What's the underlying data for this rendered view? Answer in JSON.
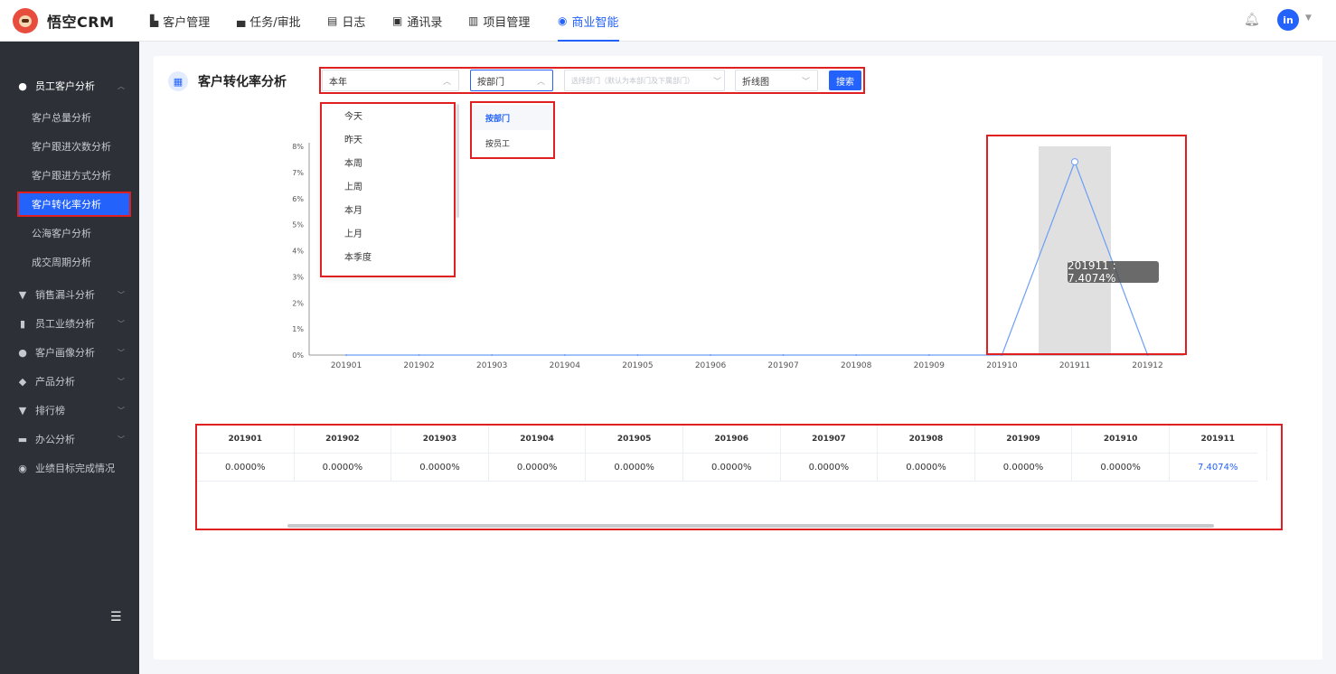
{
  "app": {
    "name": "悟空CRM"
  },
  "topnav": [
    {
      "icon": "▙",
      "label": "客户管理",
      "x": 166
    },
    {
      "icon": "▄",
      "label": "任务/审批",
      "x": 262
    },
    {
      "icon": "▤",
      "label": "日志",
      "x": 362
    },
    {
      "icon": "▣",
      "label": "通讯录",
      "x": 434
    },
    {
      "icon": "▥",
      "label": "项目管理",
      "x": 518
    },
    {
      "icon": "◉",
      "label": "商业智能",
      "x": 617
    }
  ],
  "user": {
    "avatar": "in"
  },
  "sidebar": {
    "group_staff": "员工客户分析",
    "items": [
      "客户总量分析",
      "客户跟进次数分析",
      "客户跟进方式分析",
      "客户转化率分析",
      "公海客户分析",
      "成交周期分析"
    ],
    "groups": [
      "销售漏斗分析",
      "员工业绩分析",
      "客户画像分析",
      "产品分析",
      "排行榜",
      "办公分析",
      "业绩目标完成情况"
    ]
  },
  "page": {
    "title": "客户转化率分析"
  },
  "filters": {
    "time": "本年",
    "dimension": "按部门",
    "dept_placeholder": "选择部门（默认为本部门及下属部门）",
    "chart_type": "折线图",
    "search": "搜索",
    "time_options": [
      "今天",
      "昨天",
      "本周",
      "上周",
      "本月",
      "上月",
      "本季度"
    ],
    "dimension_options": [
      "按部门",
      "按员工"
    ]
  },
  "tooltip": "201911 : 7.4074%",
  "chart_data": {
    "type": "line",
    "categories": [
      "201901",
      "201902",
      "201903",
      "201904",
      "201905",
      "201906",
      "201907",
      "201908",
      "201909",
      "201910",
      "201911",
      "201912"
    ],
    "values": [
      0,
      0,
      0,
      0,
      0,
      0,
      0,
      0,
      0,
      0,
      7.4074,
      0
    ],
    "yticks": [
      "0%",
      "1%",
      "2%",
      "3%",
      "4%",
      "5%",
      "6%",
      "7%",
      "8%"
    ],
    "ylim": [
      0,
      8
    ],
    "highlight_index": 10,
    "color": "#6b9ff5"
  },
  "table": {
    "headers": [
      "201901",
      "201902",
      "201903",
      "201904",
      "201905",
      "201906",
      "201907",
      "201908",
      "201909",
      "201910",
      "201911"
    ],
    "values": [
      "0.0000%",
      "0.0000%",
      "0.0000%",
      "0.0000%",
      "0.0000%",
      "0.0000%",
      "0.0000%",
      "0.0000%",
      "0.0000%",
      "0.0000%",
      "7.4074%"
    ]
  }
}
